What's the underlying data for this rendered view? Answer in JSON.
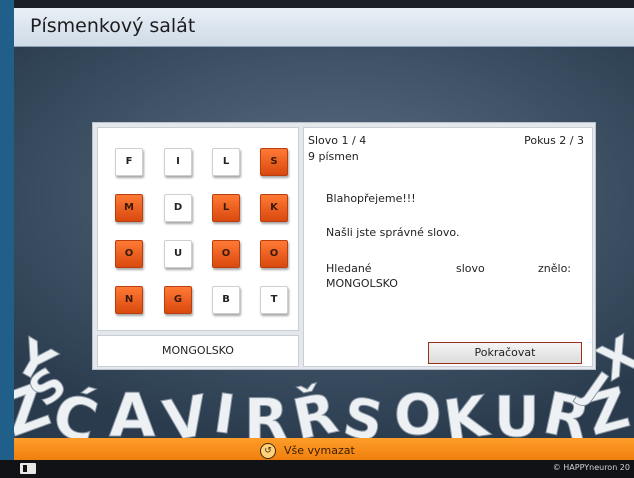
{
  "window": {
    "title": "Písmenkový salát"
  },
  "grid": {
    "rows": [
      [
        {
          "letter": "F",
          "style": "white"
        },
        {
          "letter": "I",
          "style": "white"
        },
        {
          "letter": "L",
          "style": "white"
        },
        {
          "letter": "S",
          "style": "orange"
        }
      ],
      [
        {
          "letter": "M",
          "style": "orange"
        },
        {
          "letter": "D",
          "style": "white"
        },
        {
          "letter": "L",
          "style": "orange"
        },
        {
          "letter": "K",
          "style": "orange"
        }
      ],
      [
        {
          "letter": "O",
          "style": "orange"
        },
        {
          "letter": "U",
          "style": "white"
        },
        {
          "letter": "O",
          "style": "orange"
        },
        {
          "letter": "O",
          "style": "orange"
        }
      ],
      [
        {
          "letter": "N",
          "style": "orange"
        },
        {
          "letter": "G",
          "style": "orange"
        },
        {
          "letter": "B",
          "style": "white"
        },
        {
          "letter": "T",
          "style": "white"
        }
      ]
    ]
  },
  "current_word": "MONGOLSKO",
  "info": {
    "word_counter": "Slovo 1 / 4",
    "attempt_counter": "Pokus 2 / 3",
    "letter_count": "9 písmen",
    "congrats": "Blahopřejeme!!!",
    "found_message": "Našli jste správné slovo.",
    "searched_label_1": "Hledané",
    "searched_label_2": "slovo",
    "searched_label_3": "znělo:",
    "searched_word": "MONGOLSKO",
    "continue_label": "Pokračovat"
  },
  "bottom": {
    "clear_all_label": "Vše vymazat"
  },
  "footer": {
    "copyright": "© HAPPYneuron 20"
  },
  "colors": {
    "orange_tile": "#e35a1b",
    "bottom_bar": "#f5891a"
  }
}
